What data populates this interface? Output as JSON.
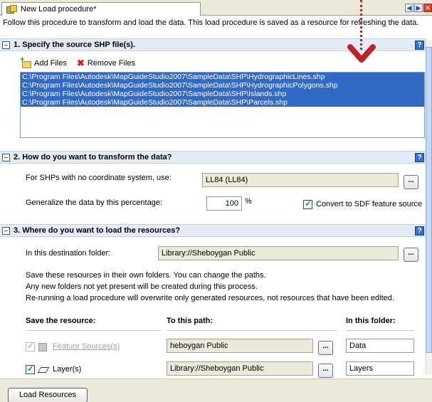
{
  "tab": {
    "title": "New Load procedure*"
  },
  "description": "Follow this procedure to transform and load the data. This load procedure is saved as a resource for refreshing the data.",
  "section1": {
    "title": "1. Specify the source SHP file(s).",
    "help": "?",
    "add_files": "Add Files",
    "remove_files": "Remove Files",
    "files": [
      "C:\\Program Files\\Autodesk\\MapGuideStudio2007\\SampleData\\SHP\\HydrographicLines.shp",
      "C:\\Program Files\\Autodesk\\MapGuideStudio2007\\SampleData\\SHP\\HydrographicPolygons.shp",
      "C:\\Program Files\\Autodesk\\MapGuideStudio2007\\SampleData\\SHP\\Islands.shp",
      "C:\\Program Files\\Autodesk\\MapGuideStudio2007\\SampleData\\SHP\\Parcels.shp"
    ]
  },
  "section2": {
    "title": "2. How do you want to transform the data?",
    "help": "?",
    "coord_label": "For SHPs with no coordinate system, use:",
    "coord_value": "LL84 (LL84)",
    "browse": "...",
    "generalize_label": "Generalize the data by this percentage:",
    "generalize_value": "100",
    "percent_sign": "%",
    "convert_label": "Convert to SDF feature source",
    "convert_checked": true
  },
  "section3": {
    "title": "3. Where do you want to load the resources?",
    "help": "?",
    "dest_label": "In this destination folder:",
    "dest_value": "Library://Sheboygan Public",
    "browse": "...",
    "info_lines": [
      "Save these resources in their own folders. You can change the paths.",
      "Any new folders not yet present will be created during this process.",
      "Re-running a load procedure will overwrite only generated resources, not resources that have been edited."
    ],
    "col_save": "Save the resource:",
    "col_path": "To this path:",
    "col_folder": "In this folder:",
    "rows": [
      {
        "label": "Feature Sources(s)",
        "path": "heboygan Public",
        "folder": "Data",
        "checked": true,
        "enabled": false
      },
      {
        "label": "Layer(s)",
        "path": "Library://Sheboygan Public",
        "folder": "Layers",
        "checked": true,
        "enabled": true
      }
    ]
  },
  "footer": {
    "load_button": "Load Resources"
  },
  "colors": {
    "selection": "#316ac5",
    "header_bg": "#e3ebf6",
    "annotation": "#c0202a"
  }
}
